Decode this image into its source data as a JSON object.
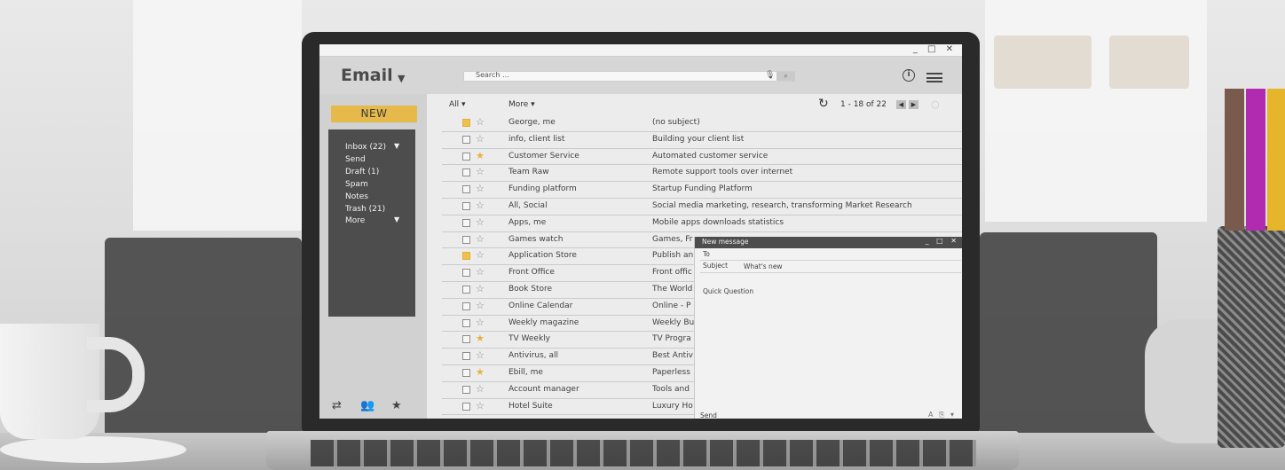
{
  "window": {
    "controls": "_ □ ✕"
  },
  "header": {
    "title": "Email",
    "search_placeholder": "Search ..."
  },
  "sidebar": {
    "new_label": "NEW",
    "folders": [
      {
        "label": "Inbox (22)",
        "caret": true
      },
      {
        "label": "Send"
      },
      {
        "label": "Draft (1)"
      },
      {
        "label": "Spam"
      },
      {
        "label": "Notes"
      },
      {
        "label": "Trash (21)"
      },
      {
        "label": "More",
        "caret": true
      }
    ]
  },
  "toolbar": {
    "all_label": "All",
    "more_label": "More",
    "range": "1 - 18 of 22"
  },
  "emails": [
    {
      "sender": "George, me",
      "subject": "(no subject)",
      "checked": true,
      "starred": false
    },
    {
      "sender": "info, client list",
      "subject": "Building your client list",
      "checked": false,
      "starred": false
    },
    {
      "sender": "Customer Service",
      "subject": "Automated customer service",
      "checked": false,
      "starred": true
    },
    {
      "sender": "Team Raw",
      "subject": "Remote support tools over internet",
      "checked": false,
      "starred": false
    },
    {
      "sender": "Funding platform",
      "subject": "Startup Funding Platform",
      "checked": false,
      "starred": false
    },
    {
      "sender": "All, Social",
      "subject": "Social media marketing, research, transforming Market Research",
      "checked": false,
      "starred": false
    },
    {
      "sender": "Apps, me",
      "subject": "Mobile apps downloads statistics",
      "checked": false,
      "starred": false
    },
    {
      "sender": "Games watch",
      "subject": "Games, Fr",
      "checked": false,
      "starred": false
    },
    {
      "sender": "Application Store",
      "subject": "Publish an",
      "checked": true,
      "starred": false
    },
    {
      "sender": "Front Office",
      "subject": "Front offic",
      "checked": false,
      "starred": false
    },
    {
      "sender": "Book Store",
      "subject": "The World",
      "checked": false,
      "starred": false
    },
    {
      "sender": "Online Calendar",
      "subject": "Online - P",
      "checked": false,
      "starred": false
    },
    {
      "sender": "Weekly magazine",
      "subject": "Weekly Bu",
      "checked": false,
      "starred": false
    },
    {
      "sender": "TV Weekly",
      "subject": "TV Progra",
      "checked": false,
      "starred": true
    },
    {
      "sender": "Antivirus, all",
      "subject": "Best Antiv",
      "checked": false,
      "starred": false
    },
    {
      "sender": "Ebill, me",
      "subject": "Paperless",
      "checked": false,
      "starred": true
    },
    {
      "sender": "Account manager",
      "subject": "Tools and",
      "checked": false,
      "starred": false
    },
    {
      "sender": "Hotel Suite",
      "subject": "Luxury Ho",
      "checked": false,
      "starred": false
    }
  ],
  "compose": {
    "title": "New message",
    "controls": "_ □ ✕",
    "to_label": "To",
    "subject_label": "Subject",
    "subject_value": "What's new",
    "body": "Quick Question",
    "send_label": "Send"
  },
  "colors": {
    "accent": "#e5b94a",
    "panel": "#4d4d4d"
  }
}
